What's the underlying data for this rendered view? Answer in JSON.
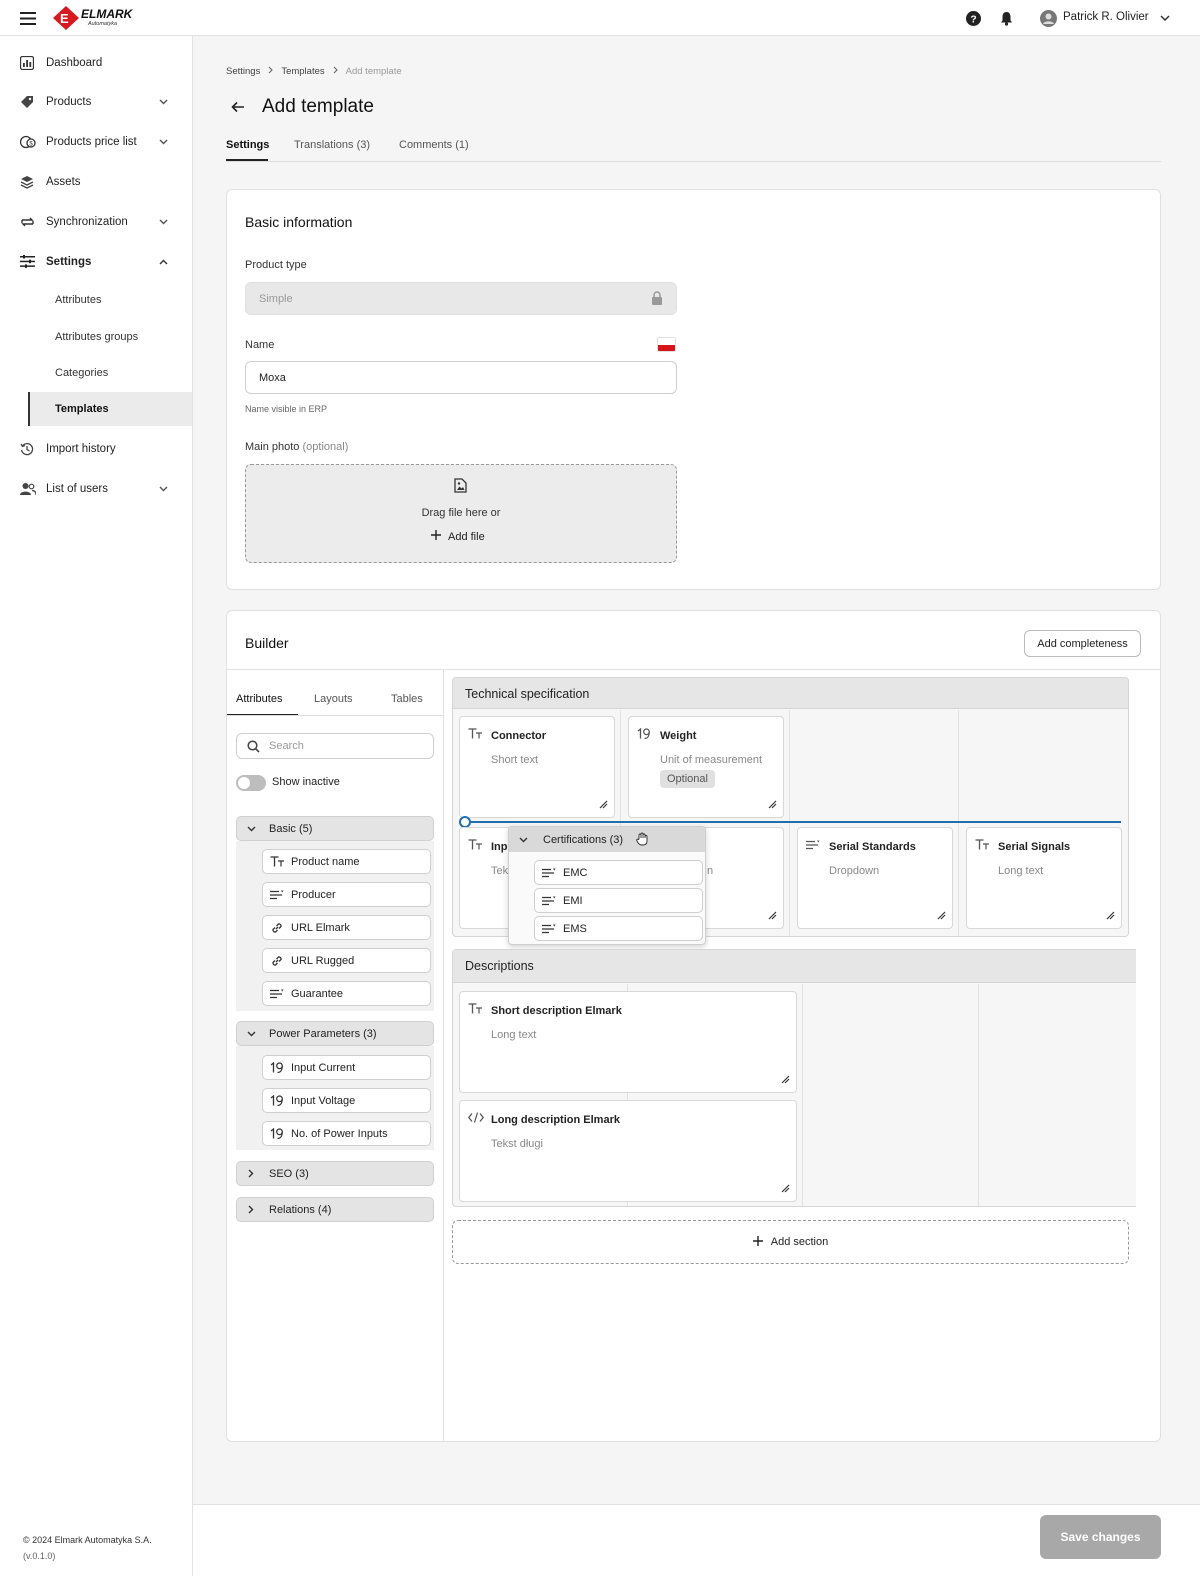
{
  "header": {
    "brand": "ELMARK",
    "brand_sub": "Automatyka",
    "user_name": "Patrick R. Olivier"
  },
  "sidebar": {
    "items": [
      {
        "label": "Dashboard"
      },
      {
        "label": "Products"
      },
      {
        "label": "Products price list"
      },
      {
        "label": "Assets"
      },
      {
        "label": "Synchronization"
      },
      {
        "label": "Settings"
      }
    ],
    "settings_sub": [
      "Attributes",
      "Attributes groups",
      "Categories",
      "Templates"
    ],
    "items2": [
      {
        "label": "Import history"
      },
      {
        "label": "List of users"
      }
    ],
    "footer": "© 2024 Elmark Automatyka S.A.",
    "version": "(v.0.1.0)"
  },
  "breadcrumb": [
    "Settings",
    "Templates",
    "Add template"
  ],
  "page_title": "Add template",
  "tabs": [
    "Settings",
    "Translations (3)",
    "Comments (1)"
  ],
  "basic": {
    "title": "Basic information",
    "product_type_label": "Product type",
    "product_type_value": "Simple",
    "name_label": "Name",
    "name_value": "Moxa",
    "name_hint": "Name visible in ERP",
    "photo_label": "Main photo",
    "photo_optional": "(optional)",
    "drag_text": "Drag file here or",
    "add_file": "Add file"
  },
  "builder": {
    "title": "Builder",
    "add_completeness": "Add completeness",
    "tabs": [
      "Attributes",
      "Layouts",
      "Tables"
    ],
    "search_placeholder": "Search",
    "show_inactive": "Show inactive",
    "groups": [
      {
        "label": "Basic (5)",
        "items": [
          {
            "label": "Product name",
            "icon": "text-icon"
          },
          {
            "label": "Producer",
            "icon": "dropdown-icon"
          },
          {
            "label": "URL Elmark",
            "icon": "link-icon"
          },
          {
            "label": "URL Rugged",
            "icon": "link-icon"
          },
          {
            "label": "Guarantee",
            "icon": "dropdown-icon"
          }
        ]
      },
      {
        "label": "Power Parameters (3)",
        "items": [
          {
            "label": "Input Current",
            "icon": "number-icon"
          },
          {
            "label": "Input Voltage",
            "icon": "number-icon"
          },
          {
            "label": "No. of Power Inputs",
            "icon": "number-icon"
          }
        ]
      },
      {
        "label": "SEO (3)"
      },
      {
        "label": "Relations (4)"
      }
    ],
    "section1": {
      "title": "Technical specification",
      "cells": [
        {
          "title": "Connector",
          "sub": "Short text"
        },
        {
          "title": "Weight",
          "sub": "Unit of measurement",
          "badge": "Optional"
        },
        {
          "title": "Inp",
          "sub": "Tek"
        },
        {
          "title": "",
          "sub": "n"
        },
        {
          "title": "Serial Standards",
          "sub": "Dropdown"
        },
        {
          "title": "Serial Signals",
          "sub": "Long text"
        }
      ]
    },
    "drag": {
      "title": "Certifications (3)",
      "items": [
        "EMC",
        "EMI",
        "EMS"
      ]
    },
    "section2": {
      "title": "Descriptions",
      "cells": [
        {
          "title": "Short description Elmark",
          "sub": "Long text"
        },
        {
          "title": "Long description Elmark",
          "sub": "Tekst długi"
        }
      ]
    },
    "add_section": "Add section"
  },
  "save": "Save changes"
}
